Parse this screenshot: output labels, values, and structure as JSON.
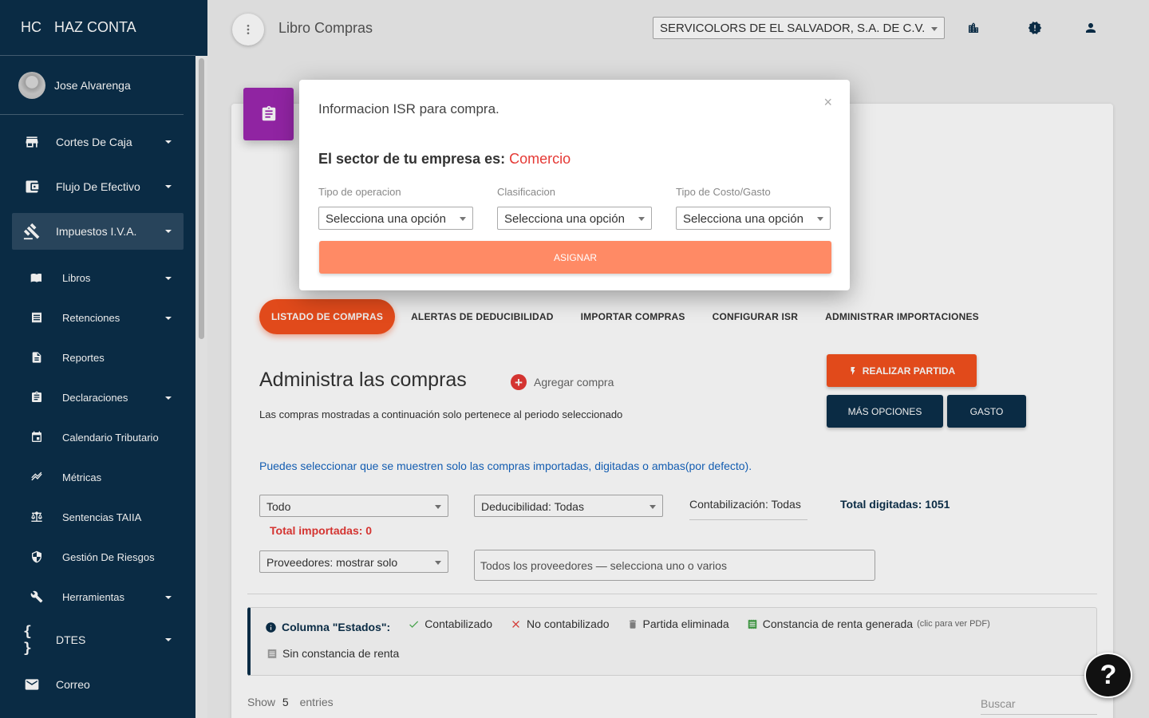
{
  "brand": {
    "short": "HC",
    "name": "HAZ CONTA"
  },
  "user": {
    "name": "Jose Alvarenga"
  },
  "sidebar": {
    "items": [
      {
        "label": "Cortes De Caja",
        "icon": "store-icon"
      },
      {
        "label": "Flujo De Efectivo",
        "icon": "wallet-icon"
      },
      {
        "label": "Impuestos I.V.A.",
        "icon": "gavel-icon"
      }
    ],
    "sub_items": [
      {
        "label": "Libros",
        "icon": "book-icon"
      },
      {
        "label": "Retenciones",
        "icon": "receipt-icon"
      },
      {
        "label": "Reportes",
        "icon": "document-icon"
      },
      {
        "label": "Declaraciones",
        "icon": "clipboard-icon"
      },
      {
        "label": "Calendario Tributario",
        "icon": "calendar-icon"
      },
      {
        "label": "Métricas",
        "icon": "trending-icon"
      },
      {
        "label": "Sentencias TAIIA",
        "icon": "balance-icon"
      },
      {
        "label": "Gestión De Riesgos",
        "icon": "shield-icon"
      },
      {
        "label": "Herramientas",
        "icon": "wrench-icon"
      }
    ],
    "bottom_items": [
      {
        "label": "DTES",
        "icon": "braces-icon"
      },
      {
        "label": "Correo",
        "icon": "mail-icon"
      }
    ]
  },
  "header": {
    "title": "Libro Compras",
    "company": "SERVICOLORS DE EL SALVADOR, S.A. DE C.V."
  },
  "tabs": [
    "Listado de compras",
    "Alertas de deducibilidad",
    "Importar compras",
    "Configurar ISR",
    "Administrar importaciones"
  ],
  "main": {
    "title": "Administra las compras",
    "add_label": "Agregar compra",
    "subtitle": "Las compras mostradas a continuación solo pertenece al periodo seleccionado",
    "info": "Puedes seleccionar que se muestren solo las compras importadas, digitadas o ambas(por defecto).",
    "btn_partida": "Realizar partida",
    "btn_more": "Más opciones",
    "btn_gasto": "Gasto",
    "filter_origin": "Todo",
    "filter_deduct": "Deducibilidad: Todas",
    "contab_label": "Contabilización: Todas",
    "total_digitadas": "Total digitadas: 1051",
    "total_importadas": "Total importadas: 0",
    "providers_mode": "Proveedores: mostrar solo",
    "providers_placeholder": "Todos los proveedores — selecciona uno o varios"
  },
  "legend": {
    "title": "Columna \"Estados\":",
    "contabilizado": "Contabilizado",
    "no_contabilizado": "No contabilizado",
    "partida_eliminada": "Partida eliminada",
    "constancia": "Constancia de renta generada",
    "constancia_note": "(clic para ver PDF)",
    "sin_constancia": "Sin constancia de renta"
  },
  "table": {
    "show": "Show",
    "entries_value": "5",
    "entries": "entries",
    "search": "Buscar"
  },
  "modal": {
    "title": "Informacion ISR para compra.",
    "close": "×",
    "sector_prefix": "El sector de tu empresa es:",
    "sector_value": "Comercio",
    "label_op": "Tipo de operacion",
    "label_clas": "Clasificacion",
    "label_cost": "Tipo de Costo/Gasto",
    "placeholder": "Selecciona una opción",
    "assign": "Asignar"
  },
  "help": "?",
  "colors": {
    "sidebar": "#0b2f4a",
    "accent": "#f4511e",
    "card_icon": "#9c27b0",
    "assign": "#ff8a65",
    "error": "#e53935"
  }
}
